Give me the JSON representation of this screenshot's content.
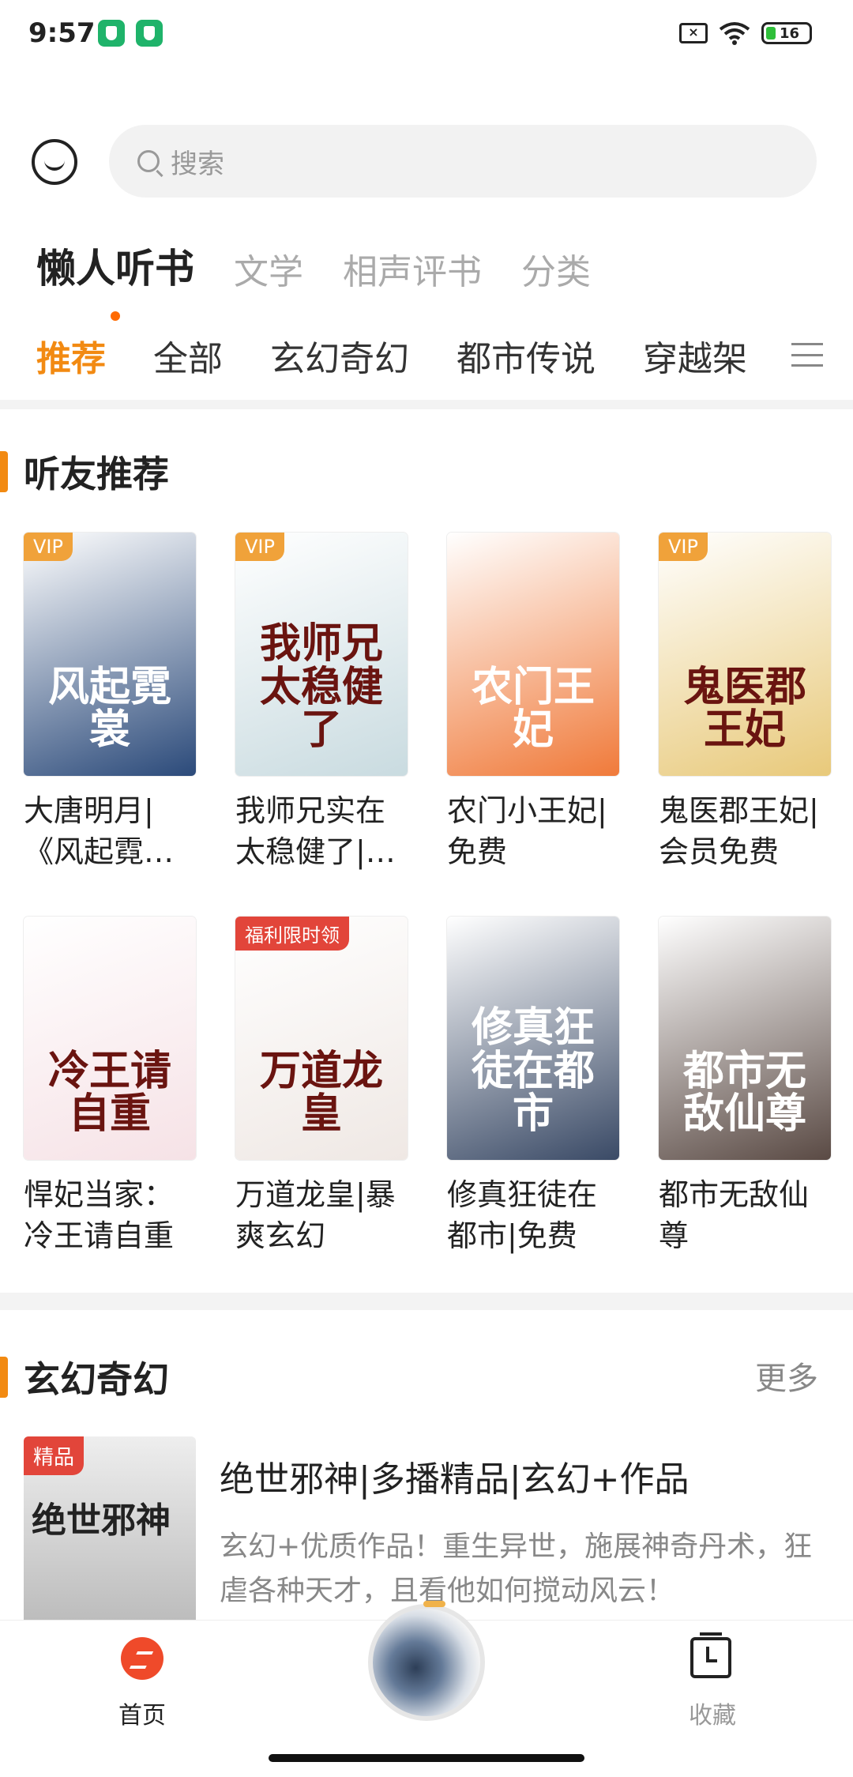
{
  "status": {
    "time": "9:57",
    "battery": "16"
  },
  "search": {
    "placeholder": "搜索"
  },
  "main_tabs": [
    {
      "label": "懒人听书",
      "active": true
    },
    {
      "label": "文学"
    },
    {
      "label": "相声评书"
    },
    {
      "label": "分类"
    }
  ],
  "category_tabs": [
    {
      "label": "推荐",
      "active": true
    },
    {
      "label": "全部"
    },
    {
      "label": "玄幻奇幻"
    },
    {
      "label": "都市传说"
    },
    {
      "label": "穿越架"
    }
  ],
  "section_recommend": {
    "title": "听友推荐",
    "books": [
      {
        "badge": "VIP",
        "title": "大唐明月|《风起霓…",
        "cover_art": "风起霓裳",
        "color": "#2b4a7a"
      },
      {
        "badge": "VIP",
        "title": "我师兄实在太稳健了|…",
        "cover_art": "我师兄太稳健了",
        "color": "#c9dbe0"
      },
      {
        "badge": "",
        "title": "农门小王妃|免费",
        "cover_art": "农门王妃",
        "color": "#f07a3a"
      },
      {
        "badge": "VIP",
        "title": "鬼医郡王妃|会员免费",
        "cover_art": "鬼医郡王妃",
        "color": "#e8c97a"
      },
      {
        "badge": "",
        "title": "悍妃当家：冷王请自重",
        "cover_art": "冷王请自重",
        "color": "#f6e2e6"
      },
      {
        "badge": "福利限时领",
        "title": "万道龙皇|暴爽玄幻",
        "cover_art": "万道龙皇",
        "color": "#efe8e4"
      },
      {
        "badge": "",
        "title": "修真狂徒在都市|免费",
        "cover_art": "修真狂徒在都市",
        "color": "#3a4a66"
      },
      {
        "badge": "",
        "title": "都市无敌仙尊",
        "cover_art": "都市无敌仙尊",
        "color": "#5a4a44"
      }
    ]
  },
  "section_fantasy": {
    "title": "玄幻奇幻",
    "more": "更多",
    "item": {
      "badge": "精品",
      "cover_art": "绝世邪神",
      "title": "绝世邪神|多播精品|玄幻+作品",
      "desc": "玄幻+优质作品！重生异世，施展神奇丹术，狂虐各种天才，且看他如何搅动风云！"
    }
  },
  "bottom_nav": {
    "home": "首页",
    "favorites": "收藏"
  }
}
